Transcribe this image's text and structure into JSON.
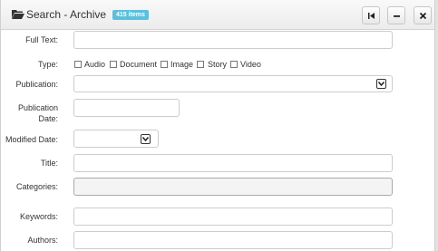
{
  "header": {
    "title": "Search - Archive",
    "badge": "415 items",
    "buttons": [
      "collapse-left",
      "minimize",
      "close"
    ]
  },
  "form": {
    "full_text_label": "Full Text:",
    "type_label": "Type:",
    "types": [
      "Audio",
      "Document",
      "Image",
      "Story",
      "Video"
    ],
    "publication_label": "Publication:",
    "publication_date_label_line1": "Publication",
    "publication_date_label_line2": "Date:",
    "modified_date_label": "Modified Date:",
    "title_label": "Title:",
    "categories_label": "Categories:",
    "keywords_label": "Keywords:",
    "authors_label": "Authors:"
  },
  "colors": {
    "badge": "#5bc0de",
    "header_bg": "#ececec"
  }
}
